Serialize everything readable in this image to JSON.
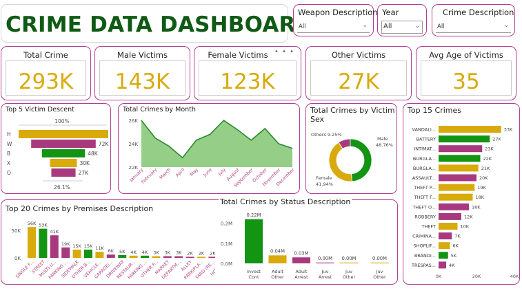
{
  "dashboard": {
    "title": "CRIME DATA DASHBOARD",
    "more_dots": "• • •"
  },
  "slicers": [
    {
      "label": "Weapon Description",
      "value": "All"
    },
    {
      "label": "Year",
      "value": "All"
    },
    {
      "label": "Crime Description",
      "value": "All"
    }
  ],
  "kpis": [
    {
      "label": "Total Crime",
      "value": "293K"
    },
    {
      "label": "Male Victims",
      "value": "143K"
    },
    {
      "label": "Female Victims",
      "value": "123K"
    },
    {
      "label": "Other Victims",
      "value": "27K"
    },
    {
      "label": "Avg Age of Victims",
      "value": "35"
    }
  ],
  "colors": {
    "green": "#139413",
    "gold": "#d9aa0c",
    "magenta": "#a8397f",
    "line": "#2a8a2a",
    "area": "#88c97a",
    "border": "#b33d93"
  },
  "chart_data": [
    {
      "type": "bar",
      "title": "Top 5 Victim Descent",
      "orientation": "funnel",
      "categories": [
        "H",
        "W",
        "B",
        "X",
        "O"
      ],
      "values": [
        100,
        72,
        48,
        30,
        27
      ],
      "data_labels": [
        "",
        "72K",
        "48K",
        "30K",
        "27K"
      ],
      "top_label": "100%",
      "bottom_label": "26.1%"
    },
    {
      "type": "area",
      "title": "Total Crimes by Month",
      "categories": [
        "January",
        "February",
        "March",
        "April",
        "May",
        "June",
        "July",
        "August",
        "September",
        "October",
        "November",
        "December"
      ],
      "values": [
        26.0,
        24.5,
        23.8,
        22.8,
        24.3,
        24.8,
        26.0,
        25.2,
        24.3,
        25.3,
        24.0,
        23.6
      ],
      "yticks": [
        "26K",
        "24K",
        "22K"
      ],
      "ylim": [
        22,
        26
      ]
    },
    {
      "type": "pie",
      "title": "Total Crimes by Victim Sex",
      "slices": [
        {
          "name": "Male",
          "pct": 48.76,
          "label": "Male\n48.76%"
        },
        {
          "name": "Female",
          "pct": 41.94,
          "label": "Female\n41.94%"
        },
        {
          "name": "Others",
          "pct": 9.25,
          "label": "Others 9.25%"
        }
      ]
    },
    {
      "type": "bar",
      "title": "Top 15 Crimes",
      "orientation": "horizontal",
      "categories": [
        "VANDALI...",
        "BATTERY",
        "INTIMAT...",
        "BURGLA...",
        "BURGLA...",
        "ASSAULT...",
        "THEFT P...",
        "THEFT F...",
        "THEFT O...",
        "ROBBERY",
        "THEFT",
        "CRIMINA...",
        "SHOPLIF...",
        "BRANDI...",
        "TRESPAS..."
      ],
      "values": [
        33,
        27,
        23,
        22,
        21,
        20,
        19,
        18,
        16,
        12,
        10,
        7,
        6,
        5,
        4
      ],
      "data_labels": [
        "33K",
        "27K",
        "23K",
        "22K",
        "21K",
        "20K",
        "19K",
        "18K",
        "16K",
        "12K",
        "10K",
        "7K",
        "6K",
        "5K",
        "4K"
      ],
      "xticks": [
        "0K",
        "20K",
        "40K"
      ],
      "xlim": [
        0,
        40
      ]
    },
    {
      "type": "bar",
      "title": "Top 20 Crimes by Premises Description",
      "categories": [
        "SINGLE F...",
        "STREET",
        "MULTI-U...",
        "PARKING ...",
        "SIDEWALK",
        "OTHER B...",
        "VEHICLE...",
        "GARAGE/...",
        "DRIVEWAY",
        "RESTAUR...",
        "PARKING ...",
        "OTHER P...",
        "MARKET",
        "DEPARTM...",
        "ALLEY",
        "PARK/PLA...",
        "YARD (RE...",
        "HOT GAS"
      ],
      "values": [
        56,
        53,
        41,
        19,
        15,
        15,
        11,
        6,
        5,
        4,
        4,
        3,
        3,
        3,
        2,
        2,
        2,
        2
      ],
      "data_labels": [
        "56K",
        "53K",
        "41K",
        "19K",
        "15K",
        "15K",
        "11K",
        "6K",
        "5K",
        "4K",
        "4K",
        "3K",
        "3K",
        "3K",
        "2K",
        "2K",
        "2K",
        "2K"
      ],
      "yticks": [
        "50K",
        "0K"
      ],
      "ylim": [
        0,
        60
      ]
    },
    {
      "type": "bar",
      "title": "Total Crimes by Status Description",
      "categories": [
        "Invest Cont",
        "Adult Other",
        "Adult Arrest",
        "Juv Arrest",
        "Juv Other",
        "Juv Other"
      ],
      "values": [
        0.22,
        0.04,
        0.03,
        0.0,
        0.0,
        0.0
      ],
      "data_labels": [
        "0.22M",
        "0.04M",
        "0.03M",
        "0.00M",
        "0.00M",
        "0.00M"
      ],
      "yticks": [
        "0.2M",
        "0.1M",
        "0.0M"
      ],
      "ylim": [
        0,
        0.24
      ]
    }
  ]
}
